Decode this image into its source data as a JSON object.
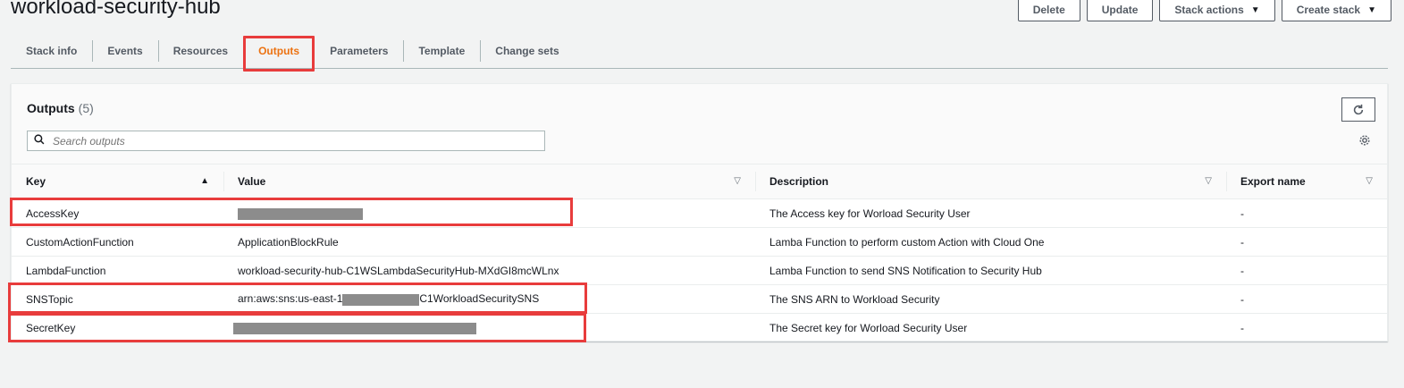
{
  "page": {
    "title": "workload-security-hub"
  },
  "actions": {
    "delete": "Delete",
    "update": "Update",
    "stack_actions": "Stack actions",
    "create_stack": "Create stack"
  },
  "tabs": [
    "Stack info",
    "Events",
    "Resources",
    "Outputs",
    "Parameters",
    "Template",
    "Change sets"
  ],
  "active_tab": "Outputs",
  "outputs": {
    "title": "Outputs",
    "count": "(5)",
    "search_placeholder": "Search outputs",
    "columns": {
      "key": "Key",
      "value": "Value",
      "description": "Description",
      "export_name": "Export name"
    },
    "rows": [
      {
        "key": "AccessKey",
        "value": "",
        "description": "The Access key for Worload Security User",
        "export": "-"
      },
      {
        "key": "CustomActionFunction",
        "value": "ApplicationBlockRule",
        "description": "Lamba Function to perform custom Action with Cloud One",
        "export": "-"
      },
      {
        "key": "LambdaFunction",
        "value": "workload-security-hub-C1WSLambdaSecurityHub-MXdGI8mcWLnx",
        "description": "Lamba Function to send SNS Notification to Security Hub",
        "export": "-"
      },
      {
        "key": "SNSTopic",
        "value_prefix": "arn:aws:sns:us-east-1",
        "value_suffix": "C1WorkloadSecuritySNS",
        "description": "The SNS ARN to Workload Security",
        "export": "-"
      },
      {
        "key": "SecretKey",
        "value": "",
        "description": "The Secret key for Worload Security User",
        "export": "-"
      }
    ]
  },
  "icons": {
    "search": "search-icon",
    "refresh": "refresh-icon",
    "settings": "gear-icon"
  },
  "colors": {
    "accent": "#ec7211",
    "highlight": "#e83c3c",
    "redaction": "#8c8c8c"
  }
}
